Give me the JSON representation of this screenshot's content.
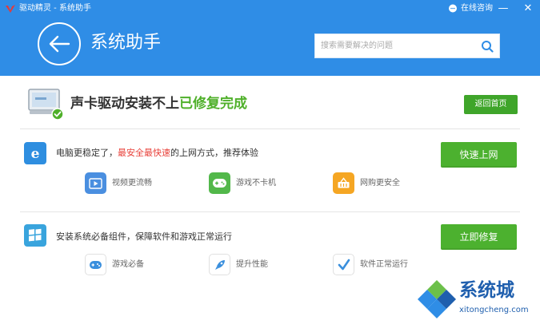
{
  "window": {
    "app_title": "驱动精灵 - 系统助手",
    "feedback_label": "在线咨询",
    "minimize_glyph": "—",
    "close_glyph": "✕"
  },
  "header": {
    "page_title": "系统助手",
    "search_placeholder": "搜索需要解决的问题"
  },
  "result": {
    "text_main": "声卡驱动安装不上",
    "text_status": "已修复完成",
    "home_button": "返回首页"
  },
  "browser_section": {
    "icon": "ie-browser-icon",
    "text_before": "电脑更稳定了，",
    "text_highlight": "最安全最快速",
    "text_after": "的上网方式，推荐体验",
    "button": "快速上网",
    "features": [
      {
        "icon": "video-icon",
        "label": "视频更流畅",
        "color": "#4a8fe0"
      },
      {
        "icon": "gamepad-icon",
        "label": "游戏不卡机",
        "color": "#52b84a"
      },
      {
        "icon": "shopping-basket-icon",
        "label": "网购更安全",
        "color": "#f5a623"
      }
    ]
  },
  "repair_section": {
    "icon": "windows-icon",
    "text": "安装系统必备组件，保障软件和游戏正常运行",
    "button": "立即修复",
    "features": [
      {
        "icon": "gamepad-icon",
        "label": "游戏必备"
      },
      {
        "icon": "rocket-icon",
        "label": "提升性能"
      },
      {
        "icon": "checkmark-icon",
        "label": "软件正常运行"
      }
    ]
  },
  "watermark": {
    "name": "系统城",
    "url": "xitongcheng.com"
  },
  "colors": {
    "header_blue": "#2f8de6",
    "action_green": "#4cb12f",
    "status_green": "#4fb02a",
    "highlight_red": "#e8413a"
  }
}
